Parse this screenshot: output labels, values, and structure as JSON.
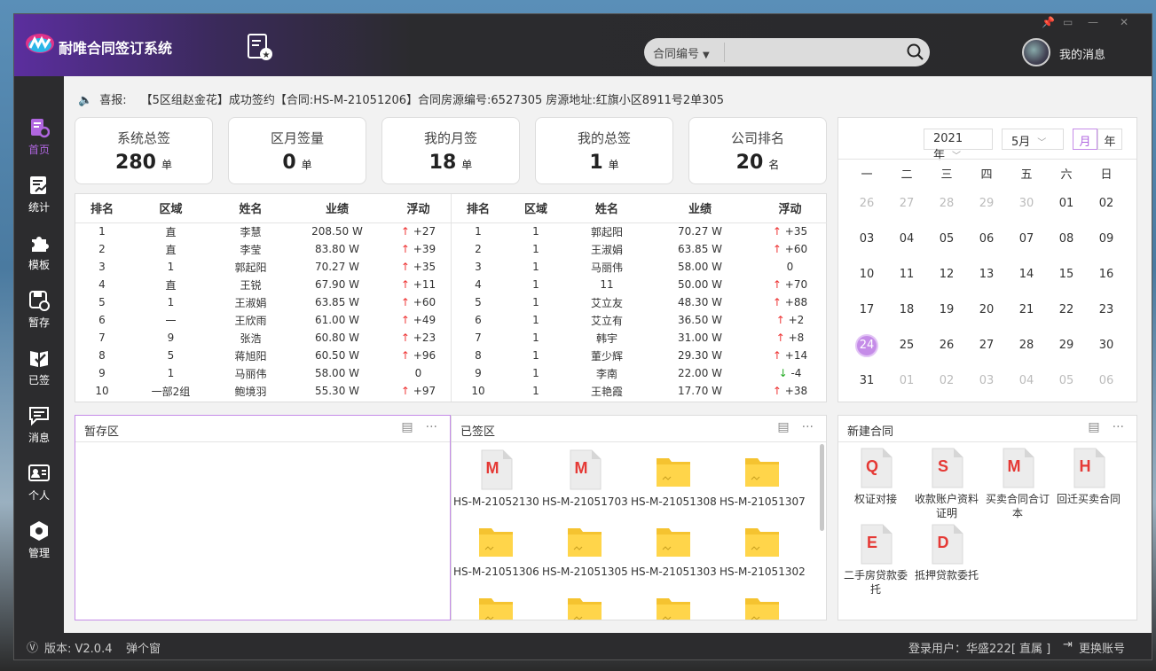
{
  "app": {
    "title": "耐唯合同签订系统",
    "search_dropdown": "合同编号",
    "search_placeholder": "",
    "my_messages": "我的消息"
  },
  "sidebar": {
    "items": [
      {
        "label": "首页",
        "icon": "document-settings-icon",
        "active": true
      },
      {
        "label": "统计",
        "icon": "report-chart-icon",
        "active": false
      },
      {
        "label": "模板",
        "icon": "puzzle-icon",
        "active": false
      },
      {
        "label": "暂存",
        "icon": "save-icon",
        "active": false
      },
      {
        "label": "已签",
        "icon": "signed-book-icon",
        "active": false
      },
      {
        "label": "消息",
        "icon": "chat-icon",
        "active": false
      },
      {
        "label": "个人",
        "icon": "id-card-icon",
        "active": false
      },
      {
        "label": "管理",
        "icon": "settings-hex-icon",
        "active": false
      }
    ]
  },
  "ticker": {
    "label": "喜报:",
    "text": "【5区组赵金花】成功签约【合同:HS-M-21051206】合同房源编号:6527305 房源地址:红旗小区8911号2单305"
  },
  "stats": [
    {
      "label": "系统总签",
      "value": "280",
      "unit": "单"
    },
    {
      "label": "区月签量",
      "value": "0",
      "unit": "单"
    },
    {
      "label": "我的月签",
      "value": "18",
      "unit": "单"
    },
    {
      "label": "我的总签",
      "value": "1",
      "unit": "单"
    },
    {
      "label": "公司排名",
      "value": "20",
      "unit": "名"
    }
  ],
  "rank_headers": [
    "排名",
    "区域",
    "姓名",
    "业绩",
    "浮动"
  ],
  "rank_left": [
    {
      "rank": "1",
      "area": "直",
      "name": "李慧",
      "perf": "208.50 W",
      "trend": "up",
      "delta": "+27"
    },
    {
      "rank": "2",
      "area": "直",
      "name": "李莹",
      "perf": "83.80 W",
      "trend": "up",
      "delta": "+39"
    },
    {
      "rank": "3",
      "area": "1",
      "name": "郭起阳",
      "perf": "70.27 W",
      "trend": "up",
      "delta": "+35"
    },
    {
      "rank": "4",
      "area": "直",
      "name": "王锐",
      "perf": "67.90 W",
      "trend": "up",
      "delta": "+11"
    },
    {
      "rank": "5",
      "area": "1",
      "name": "王淑娟",
      "perf": "63.85 W",
      "trend": "up",
      "delta": "+60"
    },
    {
      "rank": "6",
      "area": "一",
      "name": "王欣雨",
      "perf": "61.00 W",
      "trend": "up",
      "delta": "+49"
    },
    {
      "rank": "7",
      "area": "9",
      "name": "张浩",
      "perf": "60.80 W",
      "trend": "up",
      "delta": "+23"
    },
    {
      "rank": "8",
      "area": "5",
      "name": "蒋旭阳",
      "perf": "60.50 W",
      "trend": "up",
      "delta": "+96"
    },
    {
      "rank": "9",
      "area": "1",
      "name": "马丽伟",
      "perf": "58.00 W",
      "trend": "none",
      "delta": "0"
    },
    {
      "rank": "10",
      "area": "一部2组",
      "name": "鲍境羽",
      "perf": "55.30 W",
      "trend": "up",
      "delta": "+97"
    }
  ],
  "rank_right": [
    {
      "rank": "1",
      "area": "1",
      "name": "郭起阳",
      "perf": "70.27 W",
      "trend": "up",
      "delta": "+35"
    },
    {
      "rank": "2",
      "area": "1",
      "name": "王淑娟",
      "perf": "63.85 W",
      "trend": "up",
      "delta": "+60"
    },
    {
      "rank": "3",
      "area": "1",
      "name": "马丽伟",
      "perf": "58.00 W",
      "trend": "none",
      "delta": "0"
    },
    {
      "rank": "4",
      "area": "1",
      "name": "11",
      "perf": "50.00 W",
      "trend": "up",
      "delta": "+70"
    },
    {
      "rank": "5",
      "area": "1",
      "name": "艾立友",
      "perf": "48.30 W",
      "trend": "up",
      "delta": "+88"
    },
    {
      "rank": "6",
      "area": "1",
      "name": "艾立有",
      "perf": "36.50 W",
      "trend": "up",
      "delta": "+2"
    },
    {
      "rank": "7",
      "area": "1",
      "name": "韩宇",
      "perf": "31.00 W",
      "trend": "up",
      "delta": "+8"
    },
    {
      "rank": "8",
      "area": "1",
      "name": "董少辉",
      "perf": "29.30 W",
      "trend": "up",
      "delta": "+14"
    },
    {
      "rank": "9",
      "area": "1",
      "name": "李南",
      "perf": "22.00 W",
      "trend": "down",
      "delta": "-4"
    },
    {
      "rank": "10",
      "area": "1",
      "name": "王艳霞",
      "perf": "17.70 W",
      "trend": "up",
      "delta": "+38"
    }
  ],
  "calendar": {
    "year": "2021年",
    "month": "5月",
    "mode_month": "月",
    "mode_year": "年",
    "weekdays": [
      "一",
      "二",
      "三",
      "四",
      "五",
      "六",
      "日"
    ],
    "today": "24",
    "days": [
      [
        "26",
        "m"
      ],
      [
        "27",
        "m"
      ],
      [
        "28",
        "m"
      ],
      [
        "29",
        "m"
      ],
      [
        "30",
        "m"
      ],
      [
        "01",
        ""
      ],
      [
        "02",
        ""
      ],
      [
        "03",
        ""
      ],
      [
        "04",
        ""
      ],
      [
        "05",
        ""
      ],
      [
        "06",
        ""
      ],
      [
        "07",
        ""
      ],
      [
        "08",
        ""
      ],
      [
        "09",
        ""
      ],
      [
        "10",
        ""
      ],
      [
        "11",
        ""
      ],
      [
        "12",
        ""
      ],
      [
        "13",
        ""
      ],
      [
        "14",
        ""
      ],
      [
        "15",
        ""
      ],
      [
        "16",
        ""
      ],
      [
        "17",
        ""
      ],
      [
        "18",
        ""
      ],
      [
        "19",
        ""
      ],
      [
        "20",
        ""
      ],
      [
        "21",
        ""
      ],
      [
        "22",
        ""
      ],
      [
        "23",
        ""
      ],
      [
        "24",
        "t"
      ],
      [
        "25",
        ""
      ],
      [
        "26",
        ""
      ],
      [
        "27",
        ""
      ],
      [
        "28",
        ""
      ],
      [
        "29",
        ""
      ],
      [
        "30",
        ""
      ],
      [
        "31",
        ""
      ],
      [
        "01",
        "m"
      ],
      [
        "02",
        "m"
      ],
      [
        "03",
        "m"
      ],
      [
        "04",
        "m"
      ],
      [
        "05",
        "m"
      ],
      [
        "06",
        "m"
      ]
    ]
  },
  "panels": {
    "draft_title": "暂存区",
    "signed_title": "已签区",
    "new_title": "新建合同"
  },
  "signed_files": [
    {
      "name": "HS-M-21052130",
      "type": "doc",
      "letter": "M"
    },
    {
      "name": "HS-M-21051703",
      "type": "doc",
      "letter": "M"
    },
    {
      "name": "HS-M-21051308",
      "type": "folder"
    },
    {
      "name": "HS-M-21051307",
      "type": "folder"
    },
    {
      "name": "HS-M-21051306",
      "type": "folder"
    },
    {
      "name": "HS-M-21051305",
      "type": "folder"
    },
    {
      "name": "HS-M-21051303",
      "type": "folder"
    },
    {
      "name": "HS-M-21051302",
      "type": "folder"
    },
    {
      "name": "",
      "type": "folder"
    },
    {
      "name": "",
      "type": "folder"
    },
    {
      "name": "",
      "type": "folder"
    },
    {
      "name": "",
      "type": "folder"
    }
  ],
  "new_contracts": [
    {
      "letter": "Q",
      "label": "权证对接"
    },
    {
      "letter": "S",
      "label": "收款账户资料证明"
    },
    {
      "letter": "M",
      "label": "买卖合同合订本"
    },
    {
      "letter": "H",
      "label": "回迁买卖合同"
    },
    {
      "letter": "E",
      "label": "二手房贷款委托"
    },
    {
      "letter": "D",
      "label": "抵押贷款委托"
    }
  ],
  "statusbar": {
    "version": "版本: V2.0.4",
    "popup": "弹个窗",
    "login_user": "登录用户：华盛222[ 直属 ]",
    "switch_account": "更换账号"
  },
  "colors": {
    "accent": "#b066e0",
    "up": "#ee3333",
    "down": "#22aa22",
    "folder": "#ffd54a",
    "doc_letter": "#e53935"
  }
}
